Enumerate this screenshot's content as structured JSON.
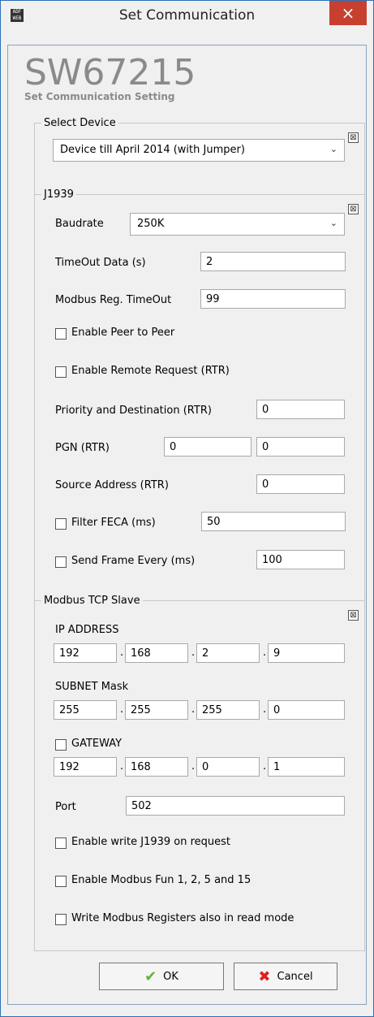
{
  "window": {
    "title": "Set Communication",
    "close_glyph": "×",
    "app_icon_text": "ADF WEB"
  },
  "brand": {
    "model": "SW67215",
    "subtitle": "Set Communication Setting"
  },
  "select_device": {
    "legend": "Select Device",
    "selected": "Device till April 2014 (with Jumper)"
  },
  "j1939": {
    "legend": "J1939",
    "baudrate_label": "Baudrate",
    "baudrate_value": "250K",
    "timeout_label": "TimeOut Data (s)",
    "timeout_value": "2",
    "modbus_timeout_label": "Modbus Reg. TimeOut",
    "modbus_timeout_value": "99",
    "peer_label": "Enable Peer to Peer",
    "rtr_label": "Enable Remote Request (RTR)",
    "prio_label": "Priority and Destination (RTR)",
    "prio_value": "0",
    "pgn_label": "PGN (RTR)",
    "pgn_value1": "0",
    "pgn_value2": "0",
    "src_label": "Source Address (RTR)",
    "src_value": "0",
    "feca_label": "Filter FECA (ms)",
    "feca_value": "50",
    "send_label": "Send Frame Every (ms)",
    "send_value": "100"
  },
  "modbus": {
    "legend": "Modbus TCP Slave",
    "ip_label": "IP ADDRESS",
    "ip": [
      "192",
      "168",
      "2",
      "9"
    ],
    "subnet_label": "SUBNET Mask",
    "subnet": [
      "255",
      "255",
      "255",
      "0"
    ],
    "gateway_label": "GATEWAY",
    "gateway": [
      "192",
      "168",
      "0",
      "1"
    ],
    "port_label": "Port",
    "port_value": "502",
    "write_j1939_label": "Enable write J1939 on request",
    "fun_label": "Enable Modbus Fun 1, 2, 5 and 15",
    "write_regs_label": "Write Modbus Registers also in read mode"
  },
  "buttons": {
    "ok": "OK",
    "cancel": "Cancel"
  },
  "collapse_glyph": "⊠"
}
